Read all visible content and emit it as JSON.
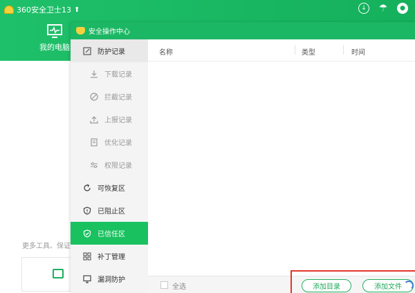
{
  "app": {
    "title": "360安全卫士13",
    "nav_pc_label": "我的电脑",
    "more_tools_text": "更多工具、保证"
  },
  "dialog": {
    "title": "安全操作中心",
    "sidebar": [
      {
        "label": "防护记录",
        "icon": "shield-edit-icon",
        "kind": "section"
      },
      {
        "label": "下载记录",
        "icon": "download-icon",
        "kind": "sub"
      },
      {
        "label": "拦截记录",
        "icon": "block-icon",
        "kind": "sub"
      },
      {
        "label": "上报记录",
        "icon": "upload-icon",
        "kind": "sub"
      },
      {
        "label": "优化记录",
        "icon": "document-icon",
        "kind": "sub"
      },
      {
        "label": "权限记录",
        "icon": "sliders-icon",
        "kind": "sub"
      },
      {
        "label": "可恢复区",
        "icon": "restore-icon",
        "kind": "section"
      },
      {
        "label": "已阻止区",
        "icon": "shield-blocked-icon",
        "kind": "section"
      },
      {
        "label": "已信任区",
        "icon": "shield-check-icon",
        "kind": "section",
        "active": true
      },
      {
        "label": "补丁管理",
        "icon": "grid-icon",
        "kind": "section"
      },
      {
        "label": "漏洞防护",
        "icon": "monitor-icon",
        "kind": "section"
      }
    ],
    "table": {
      "columns": [
        "名称",
        "类型",
        "时间"
      ],
      "rows": []
    },
    "footer": {
      "select_all": "全选",
      "add_directory": "添加目录",
      "add_file": "添加文件"
    }
  },
  "colors": {
    "brand_green": "#1cb764",
    "active_green": "#19c15f",
    "highlight_red": "#e0342b"
  }
}
